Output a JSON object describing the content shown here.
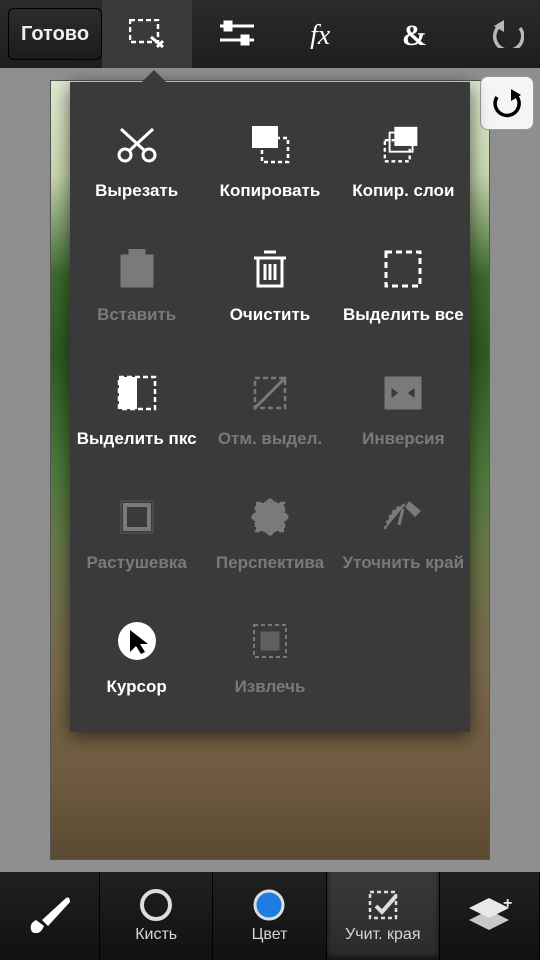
{
  "topbar": {
    "done_label": "Готово"
  },
  "panel": {
    "items": [
      {
        "id": "cut",
        "label": "Вырезать",
        "enabled": true
      },
      {
        "id": "copy",
        "label": "Копировать",
        "enabled": true
      },
      {
        "id": "copy_layers",
        "label": "Копир. слои",
        "enabled": true
      },
      {
        "id": "paste",
        "label": "Вставить",
        "enabled": false
      },
      {
        "id": "clear",
        "label": "Очистить",
        "enabled": true
      },
      {
        "id": "select_all",
        "label": "Выделить все",
        "enabled": true
      },
      {
        "id": "select_pixels",
        "label": "Выделить пкс",
        "enabled": true
      },
      {
        "id": "deselect",
        "label": "Отм. выдел.",
        "enabled": false
      },
      {
        "id": "invert",
        "label": "Инверсия",
        "enabled": false
      },
      {
        "id": "feather",
        "label": "Растушевка",
        "enabled": false
      },
      {
        "id": "perspective",
        "label": "Перспектива",
        "enabled": false
      },
      {
        "id": "refine_edge",
        "label": "Уточнить край",
        "enabled": false
      },
      {
        "id": "cursor",
        "label": "Курсор",
        "enabled": true
      },
      {
        "id": "extract",
        "label": "Извлечь",
        "enabled": false
      }
    ]
  },
  "bottombar": {
    "brush": "Кисть",
    "color": "Цвет",
    "edges": "Учит. края"
  },
  "colors": {
    "accent_blue": "#1f7de0"
  }
}
